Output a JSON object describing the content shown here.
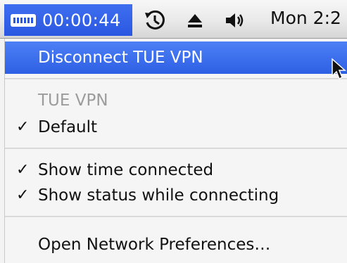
{
  "menubar": {
    "vpn_timer": "00:00:44",
    "clock": "Mon 2:2",
    "icons": [
      "vpn-status-icon",
      "time-machine-icon",
      "eject-icon",
      "volume-icon"
    ]
  },
  "menu": {
    "disconnect_label": "Disconnect TUE VPN",
    "section_header": "TUE VPN",
    "default_label": "Default",
    "show_time_label": "Show time connected",
    "show_status_label": "Show status while connecting",
    "open_prefs_label": "Open Network Preferences…",
    "check_glyph": "✓"
  },
  "colors": {
    "highlight": "#3466ea",
    "menubar": "#e9e9e9",
    "disabled_text": "#9c9c9c"
  }
}
